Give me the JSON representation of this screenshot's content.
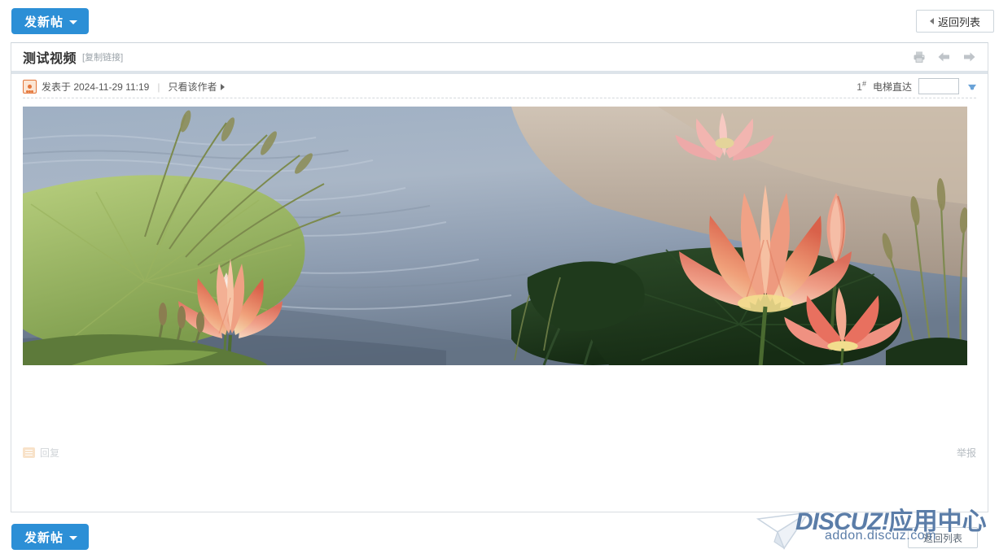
{
  "topbar": {
    "new_thread_label": "发新帖",
    "return_list_label": "返回列表"
  },
  "thread": {
    "title": "测试视频",
    "copy_link_label": "[复制链接]",
    "icons": {
      "print": "printer-icon",
      "prev": "arrow-left-icon",
      "next": "arrow-right-icon"
    }
  },
  "post": {
    "avatar": "user-avatar-icon",
    "posted_label": "发表于 2024-11-29 11:19",
    "only_author_label": "只看该作者",
    "floor_number": "1",
    "floor_number_suffix": "#",
    "elevator_label": "电梯直达",
    "elevator_input_value": "",
    "elevator_input_placeholder": "",
    "go_icon": "arrow-down-icon",
    "media_alt": "lotus-pond-video-frame"
  },
  "post_footer": {
    "reply_label": "回复",
    "reply_icon": "comment-icon",
    "report_label": "举报"
  },
  "bottombar": {
    "new_thread_label": "发新帖",
    "return_list_label": "返回列表"
  },
  "watermark": {
    "brand_en": "DISCUZ!",
    "brand_cn": "应用中心",
    "url": "addon.discuz.com"
  },
  "colors": {
    "accent_blue": "#2C8FD6",
    "separator": "#dde4ea",
    "border": "#d8dde1",
    "watermark_blue": "#5b7da8",
    "avatar_orange": "#e4763a"
  }
}
